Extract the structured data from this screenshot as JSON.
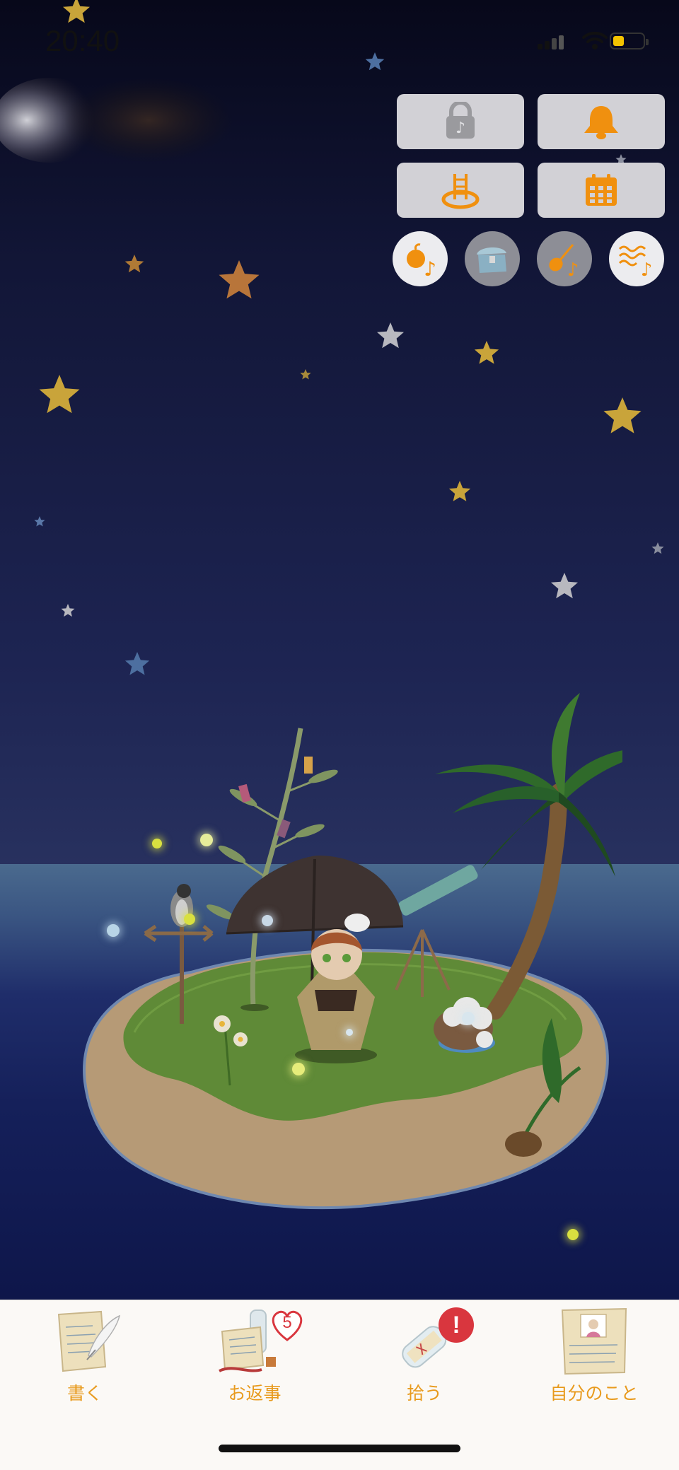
{
  "status_bar": {
    "time": "20:40",
    "battery_level_percent": 40,
    "battery_color": "#f3c300"
  },
  "controls": {
    "buttons": [
      {
        "icon": "locked-music-icon",
        "active": false
      },
      {
        "icon": "bell-icon",
        "active": true
      },
      {
        "icon": "ladder-icon",
        "active": true
      },
      {
        "icon": "calendar-icon",
        "active": true
      }
    ],
    "sound_toggles": [
      {
        "icon": "fruit-music-icon",
        "on": true
      },
      {
        "icon": "treasure-chest-icon",
        "on": false
      },
      {
        "icon": "guitar-music-icon",
        "on": false
      },
      {
        "icon": "waves-music-icon",
        "on": true
      }
    ],
    "accent_color": "#f0900f"
  },
  "tabs": [
    {
      "label": "書く",
      "icon": "write-letter-icon"
    },
    {
      "label": "お返事",
      "icon": "reply-letters-icon",
      "badge": "5"
    },
    {
      "label": "拾う",
      "icon": "bottle-pickup-icon",
      "badge": "!"
    },
    {
      "label": "自分のこと",
      "icon": "profile-letter-icon"
    }
  ],
  "colors": {
    "tab_label": "#e89a1d",
    "badge_red": "#d9363e",
    "sky_top": "#07081a",
    "sky_bottom": "#2b3463"
  }
}
